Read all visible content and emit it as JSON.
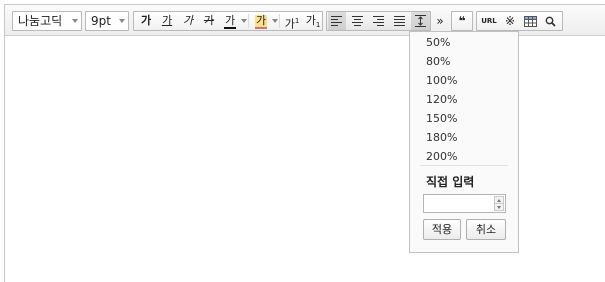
{
  "toolbar": {
    "font_family": "나눔고딕",
    "font_size": "9pt",
    "bold": "가",
    "underline": "가",
    "italic": "가",
    "strikethrough": "가",
    "font_color": "가",
    "highlight": "가",
    "superscript_base": "가",
    "superscript_mark": "1",
    "subscript_base": "가",
    "subscript_mark": "1",
    "more": "»",
    "quote": "❝",
    "url": "URL",
    "table_icon": "table-icon",
    "special_char": "※",
    "search_icon": "magnifier"
  },
  "line_height_dropdown": {
    "options": [
      "50%",
      "80%",
      "100%",
      "120%",
      "150%",
      "180%",
      "200%"
    ],
    "custom_title": "직접 입력",
    "input_value": "",
    "apply_label": "적용",
    "cancel_label": "취소"
  },
  "colors": {
    "toolbar_bg": "#eeeeee",
    "border": "#c9c9c9",
    "pressed": "#d4d4d4"
  }
}
